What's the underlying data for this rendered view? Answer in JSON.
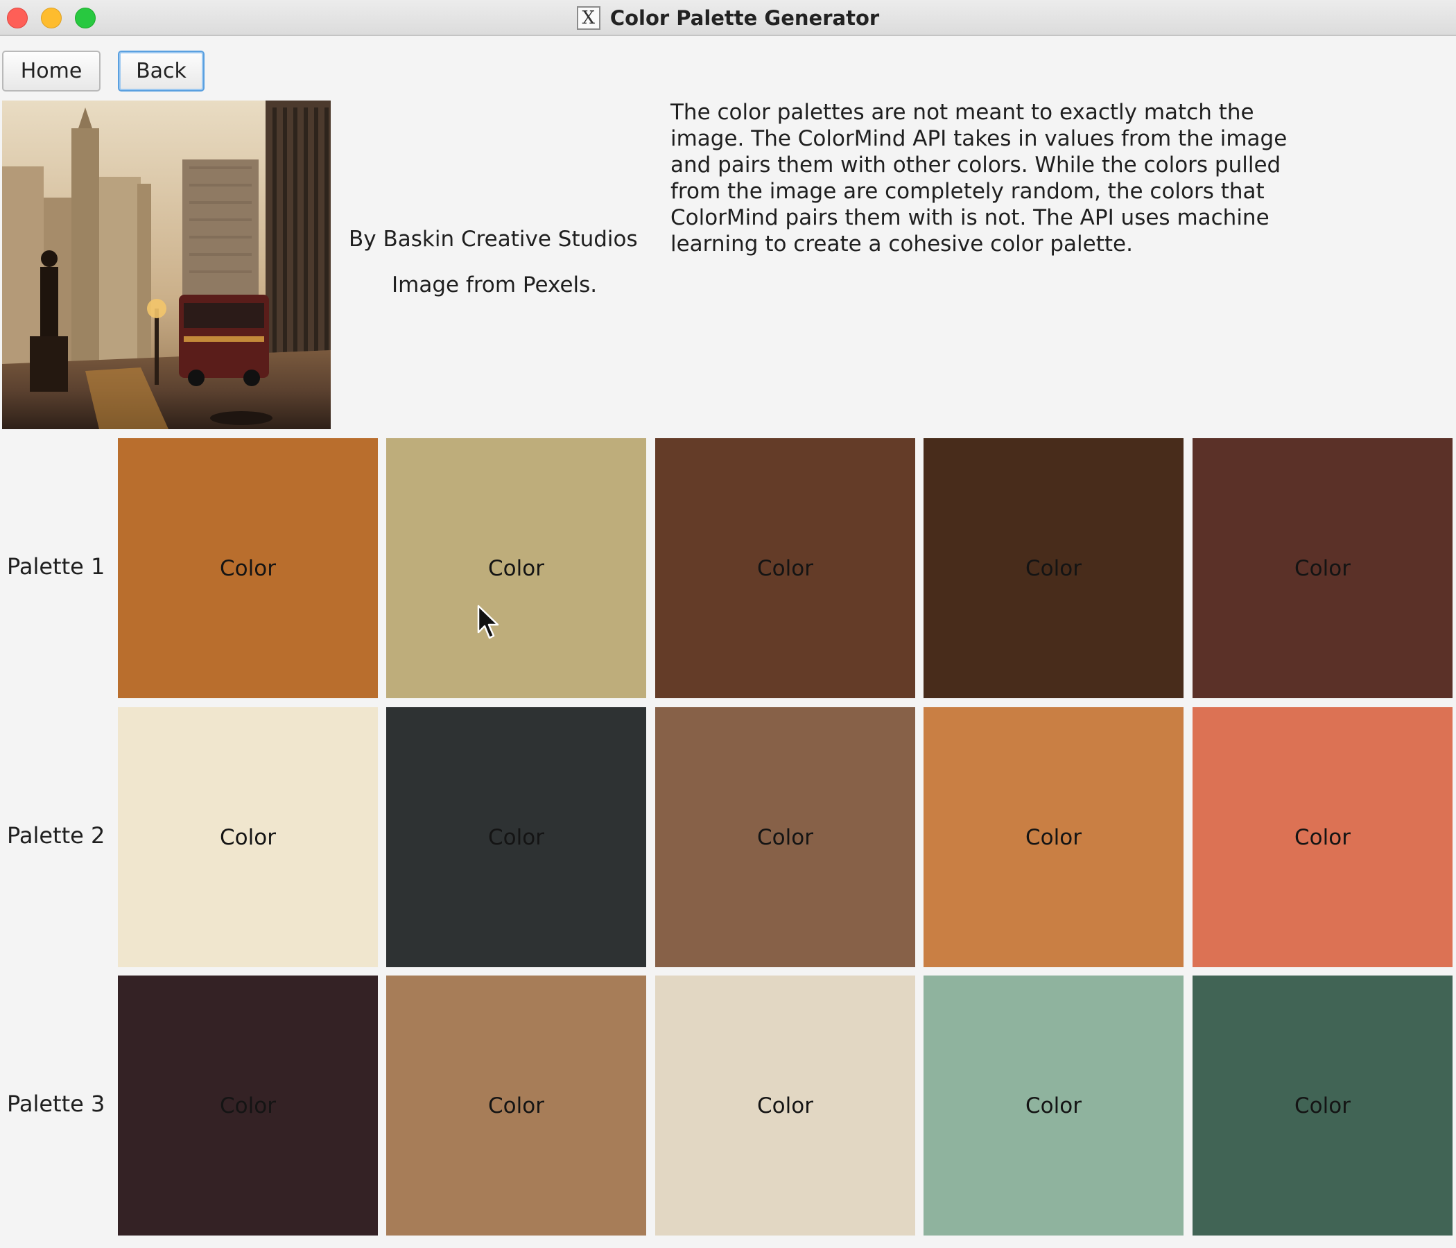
{
  "window": {
    "title": "Color Palette Generator"
  },
  "toolbar": {
    "home_label": "Home",
    "back_label": "Back"
  },
  "image_info": {
    "credit_author": "By Baskin Creative Studios",
    "credit_source": "Image from Pexels."
  },
  "description": {
    "lines": [
      "The color palettes are not meant to exactly match the",
      "image. The ColorMind API takes in values from the image",
      "and pairs them with other colors. While the colors pulled",
      "from the image are completely random, the colors that",
      "ColorMind pairs them with is not. The API uses machine",
      "learning to create a cohesive color palette."
    ]
  },
  "palettes": [
    {
      "label": "Palette 1",
      "swatches": [
        {
          "text": "Color",
          "color": "#b96e2d"
        },
        {
          "text": "Color",
          "color": "#bead7b"
        },
        {
          "text": "Color",
          "color": "#643c28"
        },
        {
          "text": "Color",
          "color": "#482c1b"
        },
        {
          "text": "Color",
          "color": "#5b3128"
        }
      ]
    },
    {
      "label": "Palette 2",
      "swatches": [
        {
          "text": "Color",
          "color": "#f0e6ce"
        },
        {
          "text": "Color",
          "color": "#2e3233"
        },
        {
          "text": "Color",
          "color": "#876148"
        },
        {
          "text": "Color",
          "color": "#c97f44"
        },
        {
          "text": "Color",
          "color": "#dc7254"
        }
      ]
    },
    {
      "label": "Palette 3",
      "swatches": [
        {
          "text": "Color",
          "color": "#342225"
        },
        {
          "text": "Color",
          "color": "#a77d58"
        },
        {
          "text": "Color",
          "color": "#e2d7c3"
        },
        {
          "text": "Color",
          "color": "#8fb39e"
        },
        {
          "text": "Color",
          "color": "#416455"
        }
      ]
    }
  ]
}
